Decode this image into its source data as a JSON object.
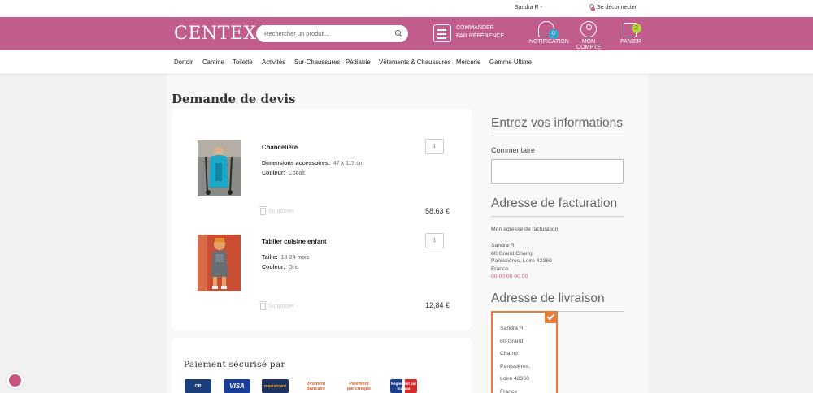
{
  "topbar": {
    "user": "Sandra R -",
    "logout": "Se déconnecter"
  },
  "header": {
    "logo": "CENTEX",
    "search_placeholder": "Rechercher un produit...",
    "order_ref": "COMMANDER PAR RÉFÉRENCE",
    "notification": {
      "label": "NOTIFICATION",
      "count": "0"
    },
    "account": {
      "label": "MON COMPTE"
    },
    "cart": {
      "label": "PANIER",
      "count": "2"
    }
  },
  "nav": [
    "Dortoir",
    "Cantine",
    "Toilette",
    "Activités",
    "Sur-Chaussures",
    "Pédiatrie",
    "Vêtements & Chaussures",
    "Mercerie",
    "Gamme Ultime"
  ],
  "page": {
    "title": "Demande de devis"
  },
  "products": [
    {
      "name": "Chancelière",
      "attrs": [
        {
          "key": "Dimensions accessoires:",
          "value": "47 x 113 cm"
        },
        {
          "key": "Couleur:",
          "value": "Cobalt"
        }
      ],
      "qty": "1",
      "delete": "Supprimer",
      "price": "58,63 €",
      "img_color": "#1aa7c8"
    },
    {
      "name": "Tablier cuisine enfant",
      "attrs": [
        {
          "key": "Taille:",
          "value": "18-24 mois"
        },
        {
          "key": "Couleur:",
          "value": "Gris"
        }
      ],
      "qty": "1",
      "delete": "Supprimer",
      "price": "12,84 €",
      "img_color": "#c94e34"
    }
  ],
  "payment": {
    "title": "Paiement sécurisé par",
    "logos": [
      "CB",
      "VISA",
      "mastercard",
      "Virement Bancaire",
      "Paiement par chèque",
      "Règlement par mandat"
    ]
  },
  "info": {
    "title": "Entrez vos informations",
    "comment_label": "Commentaire",
    "billing_title": "Adresse de facturation",
    "billing_sub": "Mon adresse de facturation",
    "billing_lines": [
      "Sandra R",
      "80 Grand Champ",
      "Panissières, Loire 42360",
      "France"
    ],
    "billing_phone": "00 00 00 00 00",
    "shipping_title": "Adresse de livraison",
    "shipping_lines": [
      "Sandra R",
      "80 Grand",
      "Champ",
      "Panissières,",
      "Loire 42360",
      "France"
    ]
  },
  "colors": {
    "brand": "#c05d8c",
    "accent_orange": "#e57b35",
    "badge_blue": "#2fa8d0",
    "badge_green": "#b6d53c"
  }
}
